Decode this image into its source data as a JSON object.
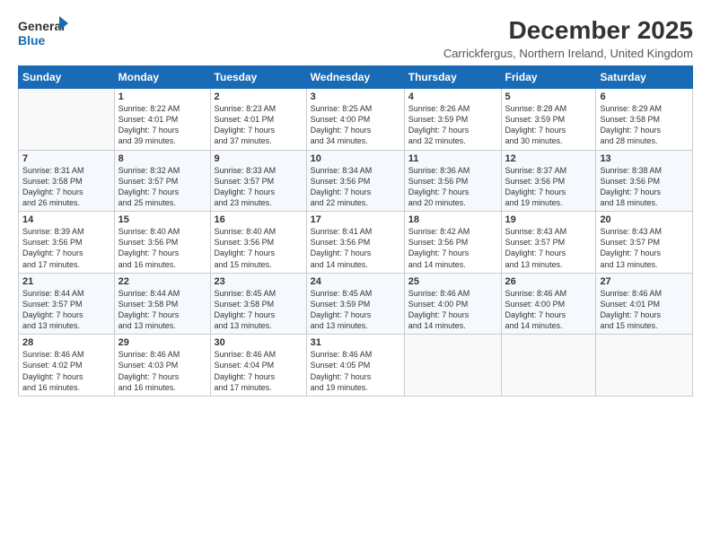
{
  "logo": {
    "line1": "General",
    "line2": "Blue"
  },
  "title": "December 2025",
  "location": "Carrickfergus, Northern Ireland, United Kingdom",
  "weekdays": [
    "Sunday",
    "Monday",
    "Tuesday",
    "Wednesday",
    "Thursday",
    "Friday",
    "Saturday"
  ],
  "weeks": [
    [
      {
        "day": "",
        "info": ""
      },
      {
        "day": "1",
        "info": "Sunrise: 8:22 AM\nSunset: 4:01 PM\nDaylight: 7 hours\nand 39 minutes."
      },
      {
        "day": "2",
        "info": "Sunrise: 8:23 AM\nSunset: 4:01 PM\nDaylight: 7 hours\nand 37 minutes."
      },
      {
        "day": "3",
        "info": "Sunrise: 8:25 AM\nSunset: 4:00 PM\nDaylight: 7 hours\nand 34 minutes."
      },
      {
        "day": "4",
        "info": "Sunrise: 8:26 AM\nSunset: 3:59 PM\nDaylight: 7 hours\nand 32 minutes."
      },
      {
        "day": "5",
        "info": "Sunrise: 8:28 AM\nSunset: 3:59 PM\nDaylight: 7 hours\nand 30 minutes."
      },
      {
        "day": "6",
        "info": "Sunrise: 8:29 AM\nSunset: 3:58 PM\nDaylight: 7 hours\nand 28 minutes."
      }
    ],
    [
      {
        "day": "7",
        "info": "Sunrise: 8:31 AM\nSunset: 3:58 PM\nDaylight: 7 hours\nand 26 minutes."
      },
      {
        "day": "8",
        "info": "Sunrise: 8:32 AM\nSunset: 3:57 PM\nDaylight: 7 hours\nand 25 minutes."
      },
      {
        "day": "9",
        "info": "Sunrise: 8:33 AM\nSunset: 3:57 PM\nDaylight: 7 hours\nand 23 minutes."
      },
      {
        "day": "10",
        "info": "Sunrise: 8:34 AM\nSunset: 3:56 PM\nDaylight: 7 hours\nand 22 minutes."
      },
      {
        "day": "11",
        "info": "Sunrise: 8:36 AM\nSunset: 3:56 PM\nDaylight: 7 hours\nand 20 minutes."
      },
      {
        "day": "12",
        "info": "Sunrise: 8:37 AM\nSunset: 3:56 PM\nDaylight: 7 hours\nand 19 minutes."
      },
      {
        "day": "13",
        "info": "Sunrise: 8:38 AM\nSunset: 3:56 PM\nDaylight: 7 hours\nand 18 minutes."
      }
    ],
    [
      {
        "day": "14",
        "info": "Sunrise: 8:39 AM\nSunset: 3:56 PM\nDaylight: 7 hours\nand 17 minutes."
      },
      {
        "day": "15",
        "info": "Sunrise: 8:40 AM\nSunset: 3:56 PM\nDaylight: 7 hours\nand 16 minutes."
      },
      {
        "day": "16",
        "info": "Sunrise: 8:40 AM\nSunset: 3:56 PM\nDaylight: 7 hours\nand 15 minutes."
      },
      {
        "day": "17",
        "info": "Sunrise: 8:41 AM\nSunset: 3:56 PM\nDaylight: 7 hours\nand 14 minutes."
      },
      {
        "day": "18",
        "info": "Sunrise: 8:42 AM\nSunset: 3:56 PM\nDaylight: 7 hours\nand 14 minutes."
      },
      {
        "day": "19",
        "info": "Sunrise: 8:43 AM\nSunset: 3:57 PM\nDaylight: 7 hours\nand 13 minutes."
      },
      {
        "day": "20",
        "info": "Sunrise: 8:43 AM\nSunset: 3:57 PM\nDaylight: 7 hours\nand 13 minutes."
      }
    ],
    [
      {
        "day": "21",
        "info": "Sunrise: 8:44 AM\nSunset: 3:57 PM\nDaylight: 7 hours\nand 13 minutes."
      },
      {
        "day": "22",
        "info": "Sunrise: 8:44 AM\nSunset: 3:58 PM\nDaylight: 7 hours\nand 13 minutes."
      },
      {
        "day": "23",
        "info": "Sunrise: 8:45 AM\nSunset: 3:58 PM\nDaylight: 7 hours\nand 13 minutes."
      },
      {
        "day": "24",
        "info": "Sunrise: 8:45 AM\nSunset: 3:59 PM\nDaylight: 7 hours\nand 13 minutes."
      },
      {
        "day": "25",
        "info": "Sunrise: 8:46 AM\nSunset: 4:00 PM\nDaylight: 7 hours\nand 14 minutes."
      },
      {
        "day": "26",
        "info": "Sunrise: 8:46 AM\nSunset: 4:00 PM\nDaylight: 7 hours\nand 14 minutes."
      },
      {
        "day": "27",
        "info": "Sunrise: 8:46 AM\nSunset: 4:01 PM\nDaylight: 7 hours\nand 15 minutes."
      }
    ],
    [
      {
        "day": "28",
        "info": "Sunrise: 8:46 AM\nSunset: 4:02 PM\nDaylight: 7 hours\nand 16 minutes."
      },
      {
        "day": "29",
        "info": "Sunrise: 8:46 AM\nSunset: 4:03 PM\nDaylight: 7 hours\nand 16 minutes."
      },
      {
        "day": "30",
        "info": "Sunrise: 8:46 AM\nSunset: 4:04 PM\nDaylight: 7 hours\nand 17 minutes."
      },
      {
        "day": "31",
        "info": "Sunrise: 8:46 AM\nSunset: 4:05 PM\nDaylight: 7 hours\nand 19 minutes."
      },
      {
        "day": "",
        "info": ""
      },
      {
        "day": "",
        "info": ""
      },
      {
        "day": "",
        "info": ""
      }
    ]
  ]
}
